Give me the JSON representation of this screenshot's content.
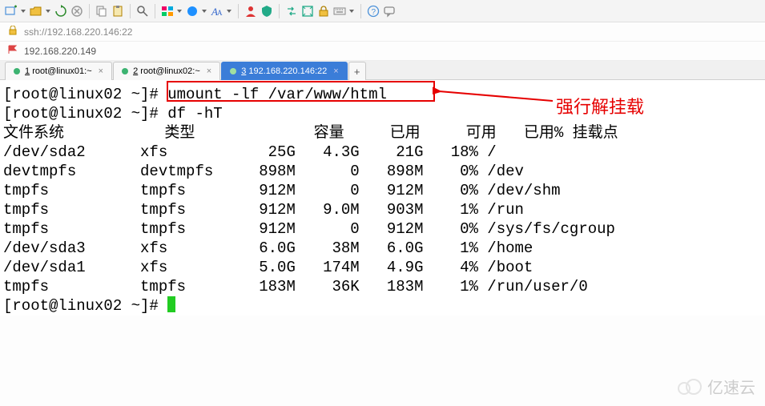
{
  "address": {
    "ssh_url": "ssh://192.168.220.146:22",
    "bookmark_ip": "192.168.220.149"
  },
  "tabs": [
    {
      "num": "1",
      "label": "root@linux01:~",
      "active": false
    },
    {
      "num": "2",
      "label": "root@linux02:~",
      "active": false
    },
    {
      "num": "3",
      "label": "192.168.220.146:22",
      "active": true
    }
  ],
  "terminal": {
    "prompt1_user": "[root@linux02 ~]# ",
    "cmd1": "umount -lf /var/www/html",
    "prompt2_user": "[root@linux02 ~]# ",
    "cmd2": "df -hT",
    "header_cols": [
      "文件系统",
      "类型",
      "容量",
      "已用",
      "可用",
      "已用%",
      "挂载点"
    ],
    "rows": [
      {
        "fs": "/dev/sda2",
        "type": "xfs",
        "size": "25G",
        "used": "4.3G",
        "avail": "21G",
        "pct": "18%",
        "mount": "/"
      },
      {
        "fs": "devtmpfs",
        "type": "devtmpfs",
        "size": "898M",
        "used": "0",
        "avail": "898M",
        "pct": "0%",
        "mount": "/dev"
      },
      {
        "fs": "tmpfs",
        "type": "tmpfs",
        "size": "912M",
        "used": "0",
        "avail": "912M",
        "pct": "0%",
        "mount": "/dev/shm"
      },
      {
        "fs": "tmpfs",
        "type": "tmpfs",
        "size": "912M",
        "used": "9.0M",
        "avail": "903M",
        "pct": "1%",
        "mount": "/run"
      },
      {
        "fs": "tmpfs",
        "type": "tmpfs",
        "size": "912M",
        "used": "0",
        "avail": "912M",
        "pct": "0%",
        "mount": "/sys/fs/cgroup"
      },
      {
        "fs": "/dev/sda3",
        "type": "xfs",
        "size": "6.0G",
        "used": "38M",
        "avail": "6.0G",
        "pct": "1%",
        "mount": "/home"
      },
      {
        "fs": "/dev/sda1",
        "type": "xfs",
        "size": "5.0G",
        "used": "174M",
        "avail": "4.9G",
        "pct": "4%",
        "mount": "/boot"
      },
      {
        "fs": "tmpfs",
        "type": "tmpfs",
        "size": "183M",
        "used": "36K",
        "avail": "183M",
        "pct": "1%",
        "mount": "/run/user/0"
      }
    ],
    "prompt3_user": "[root@linux02 ~]# "
  },
  "annotation": "强行解挂载",
  "watermark": "亿速云"
}
